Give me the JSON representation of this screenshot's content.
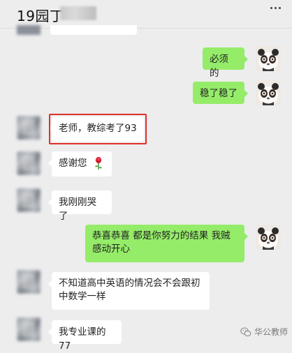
{
  "header": {
    "title": "19园丁"
  },
  "messages": [
    {
      "side": "right",
      "text": "必须的"
    },
    {
      "side": "right",
      "text": "稳了稳了"
    },
    {
      "side": "left",
      "text": "老师，教综考了93",
      "highlighted": true
    },
    {
      "side": "left",
      "text": "感谢您",
      "emoji": "rose-icon"
    },
    {
      "side": "left",
      "text": "我刚刚哭了"
    },
    {
      "side": "right",
      "text": "恭喜恭喜  都是你努力的结果 我贼感动开心"
    },
    {
      "side": "left",
      "text": "不知道高中英语的情况会不会跟初中数学一样"
    },
    {
      "side": "left",
      "text": "我专业课的77"
    }
  ],
  "watermark": {
    "text": "华公教师"
  },
  "colors": {
    "background": "#ededed",
    "bubble_right": "#95ec69",
    "bubble_left": "#ffffff",
    "highlight": "#e0302a"
  }
}
